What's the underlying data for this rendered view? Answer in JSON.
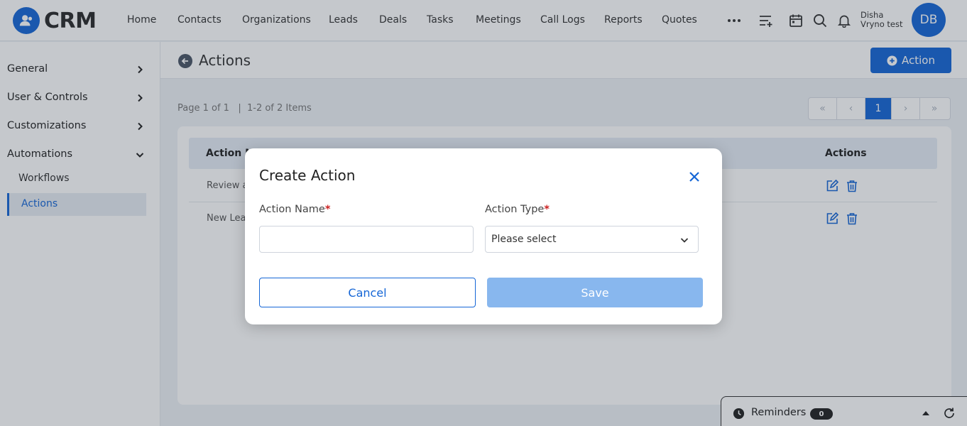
{
  "app": {
    "logo_text": "CRM"
  },
  "nav": {
    "items": [
      "Home",
      "Contacts",
      "Organizations",
      "Leads",
      "Deals",
      "Tasks",
      "Meetings",
      "Call Logs",
      "Reports",
      "Quotes"
    ],
    "more_icon": "more-horizontal-icon",
    "icons": [
      "list-add-icon",
      "calendar-icon",
      "search-icon",
      "bell-icon"
    ]
  },
  "user": {
    "name_line1": "Disha",
    "name_line2": "Vryno test",
    "initials": "DB"
  },
  "sidebar": {
    "items": [
      {
        "label": "General",
        "icon": "chevron-right-icon"
      },
      {
        "label": "User & Controls",
        "icon": "chevron-right-icon"
      },
      {
        "label": "Customizations",
        "icon": "chevron-right-icon"
      },
      {
        "label": "Automations",
        "icon": "chevron-down-icon"
      }
    ],
    "subitems": [
      {
        "label": "Workflows"
      },
      {
        "label": "Actions"
      }
    ]
  },
  "page": {
    "title": "Actions",
    "add_button": "Action",
    "pager_text": "Page 1 of 1   |  1-2 of 2 Items",
    "pager": {
      "first": "«",
      "prev": "‹",
      "current": "1",
      "next": "›",
      "last": "»"
    }
  },
  "table": {
    "headers": {
      "name": "Action N",
      "actions": "Actions"
    },
    "rows": [
      {
        "name": "Review a"
      },
      {
        "name": "New Lea"
      }
    ]
  },
  "reminders": {
    "label": "Reminders",
    "count": "0"
  },
  "modal": {
    "title": "Create Action",
    "field1_label": "Action Name",
    "field1_value": "",
    "field2_label": "Action Type",
    "field2_value": "Please select",
    "required_mark": "*",
    "cancel": "Cancel",
    "save": "Save"
  },
  "colors": {
    "primary": "#1566d6",
    "save_disabled": "#88b7ee",
    "required": "#c22222"
  }
}
